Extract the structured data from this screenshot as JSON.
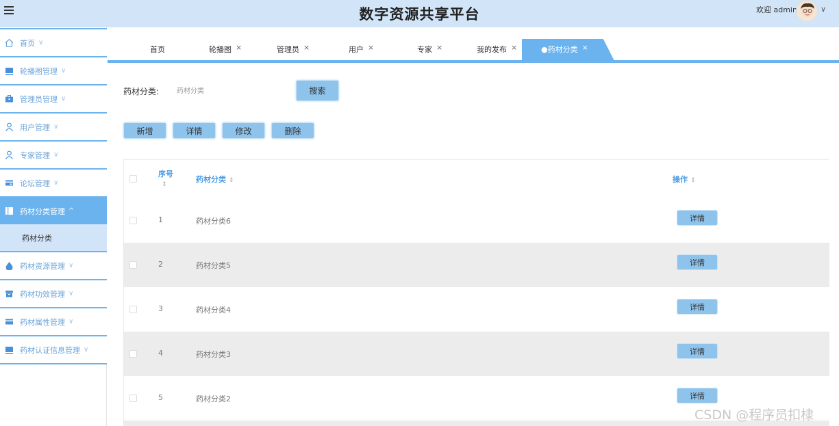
{
  "header": {
    "title": "数字资源共享平台",
    "welcome": "欢迎 admin",
    "chevron": "∨",
    "menu_icon": "hamburger-icon",
    "color": "#d2e5f8"
  },
  "sidebar": {
    "items": [
      {
        "label": "首页",
        "icon": "home-icon"
      },
      {
        "label": "轮播图管理",
        "icon": "monitor-icon"
      },
      {
        "label": "管理员管理",
        "icon": "briefcase-icon"
      },
      {
        "label": "用户管理",
        "icon": "user-icon"
      },
      {
        "label": "专家管理",
        "icon": "user-icon"
      },
      {
        "label": "论坛管理",
        "icon": "card-icon"
      },
      {
        "label": "药材分类管理",
        "icon": "book-icon"
      },
      {
        "label": "药材资源管理",
        "icon": "drop-icon"
      },
      {
        "label": "药材功效管理",
        "icon": "archive-icon"
      },
      {
        "label": "药材属性管理",
        "icon": "card-icon"
      },
      {
        "label": "药材认证信息管理",
        "icon": "monitor-icon"
      }
    ],
    "submenu": {
      "label": "药材分类"
    },
    "chev_down": "∨",
    "chev_up": "^",
    "accent": "#6ab3ee"
  },
  "tabs": [
    {
      "label": "首页",
      "close": ""
    },
    {
      "label": "轮播图",
      "close": "×"
    },
    {
      "label": "管理员",
      "close": "×"
    },
    {
      "label": "用户",
      "close": "×"
    },
    {
      "label": "专家",
      "close": "×"
    },
    {
      "label": "我的发布",
      "close": "×"
    },
    {
      "label": "●药材分类",
      "close": "×"
    }
  ],
  "search": {
    "label": "药材分类:",
    "placeholder": "药材分类",
    "button": "搜索"
  },
  "actions": {
    "add": "新增",
    "detail": "详情",
    "edit": "修改",
    "delete": "删除"
  },
  "table": {
    "columns": {
      "index": "序号",
      "category": "药材分类",
      "action": "操作",
      "sort_icon": "⇕"
    },
    "rows": [
      {
        "index": "1",
        "category": "药材分类6",
        "action": "详情"
      },
      {
        "index": "2",
        "category": "药材分类5",
        "action": "详情"
      },
      {
        "index": "3",
        "category": "药材分类4",
        "action": "详情"
      },
      {
        "index": "4",
        "category": "药材分类3",
        "action": "详情"
      },
      {
        "index": "5",
        "category": "药材分类2",
        "action": "详情"
      }
    ]
  },
  "watermark": "CSDN @程序员扣棣"
}
